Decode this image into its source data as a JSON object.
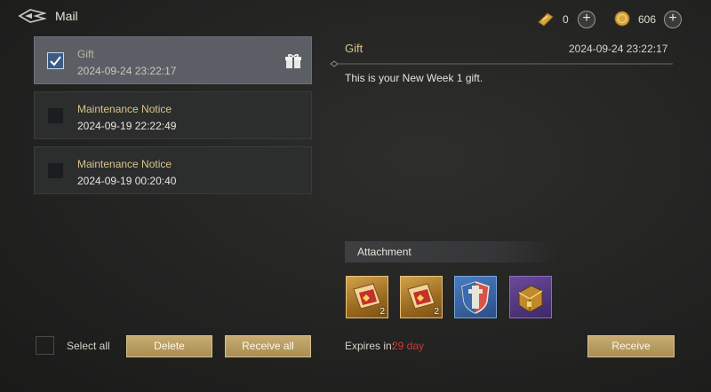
{
  "header": {
    "title": "Mail",
    "currencies": [
      {
        "icon": "gold-ticket-icon",
        "value": "0"
      },
      {
        "icon": "gold-coin-icon",
        "value": "606"
      }
    ]
  },
  "mails": [
    {
      "title": "Gift",
      "date": "2024-09-24 23:22:17",
      "selected": true,
      "has_gift": true
    },
    {
      "title": "Maintenance Notice",
      "date": "2024-09-19 22:22:49",
      "selected": false,
      "has_gift": false
    },
    {
      "title": "Maintenance Notice",
      "date": "2024-09-19 00:20:40",
      "selected": false,
      "has_gift": false
    }
  ],
  "detail": {
    "title": "Gift",
    "date": "2024-09-24 23:22:17",
    "body": "This is your New Week 1 gift.",
    "attachment_label": "Attachment",
    "attachments": [
      {
        "icon": "scroll-item-icon",
        "count": "2"
      },
      {
        "icon": "scroll-item-icon",
        "count": "2"
      },
      {
        "icon": "shield-item-icon",
        "count": ""
      },
      {
        "icon": "chest-item-icon",
        "count": ""
      }
    ],
    "expires_label": "Expires in:",
    "expires_value": "29 day",
    "receive_label": "Receive"
  },
  "footer": {
    "select_all_label": "Select all",
    "delete_label": "Delete",
    "receive_all_label": "Receive all"
  },
  "colors": {
    "accent_gold": "#d8c48a",
    "button_gold": "#b99d62",
    "expires_red": "#c93c32"
  }
}
